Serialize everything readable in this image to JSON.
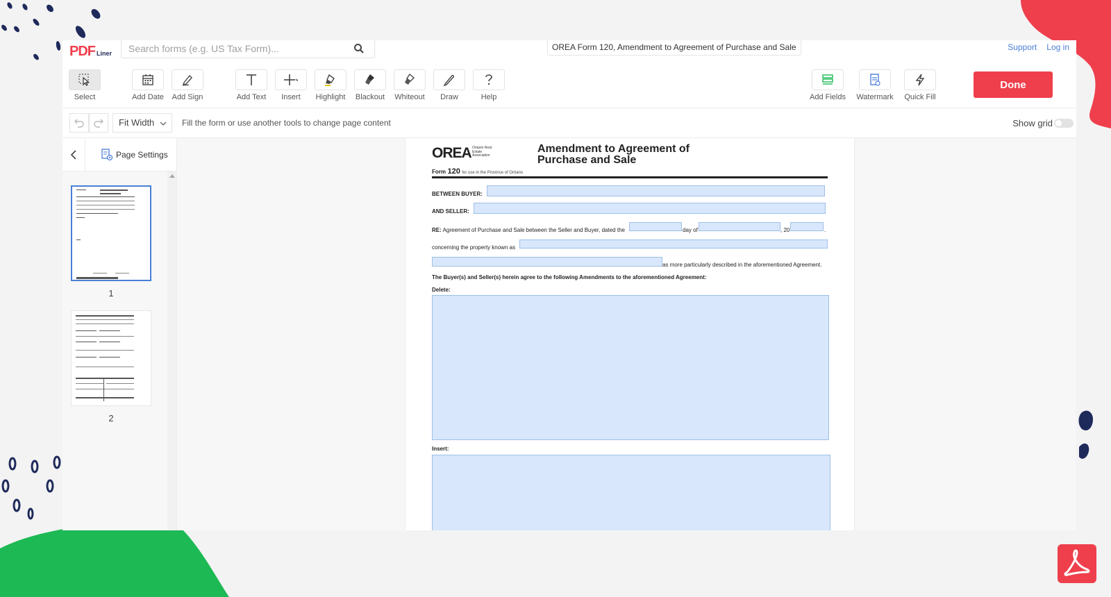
{
  "app": {
    "logo_main": "PDF",
    "logo_sub": "Liner",
    "search_placeholder": "Search forms (e.g. US Tax Form)...",
    "document_title": "OREA Form 120, Amendment to Agreement of Purchase and Sale",
    "support_label": "Support",
    "login_label": "Log in"
  },
  "toolbar": {
    "tools": [
      {
        "id": "select",
        "label": "Select",
        "icon": "cursor-icon",
        "active": true
      },
      {
        "id": "add-date",
        "label": "Add Date",
        "icon": "calendar-icon"
      },
      {
        "id": "add-sign",
        "label": "Add Sign",
        "icon": "pen-sign-icon"
      },
      {
        "id": "add-text",
        "label": "Add Text",
        "icon": "text-t-icon"
      },
      {
        "id": "insert",
        "label": "Insert",
        "icon": "plus-icon"
      },
      {
        "id": "highlight",
        "label": "Highlight",
        "icon": "highlighter-icon"
      },
      {
        "id": "blackout",
        "label": "Blackout",
        "icon": "blackout-brush-icon"
      },
      {
        "id": "whiteout",
        "label": "Whiteout",
        "icon": "whiteout-brush-icon"
      },
      {
        "id": "draw",
        "label": "Draw",
        "icon": "pencil-icon"
      },
      {
        "id": "help",
        "label": "Help",
        "icon": "question-icon"
      },
      {
        "id": "add-fields",
        "label": "Add Fields",
        "icon": "fields-icon"
      },
      {
        "id": "watermark",
        "label": "Watermark",
        "icon": "watermark-icon"
      },
      {
        "id": "quick-fill",
        "label": "Quick Fill",
        "icon": "lightning-icon"
      }
    ],
    "done_label": "Done"
  },
  "subbar": {
    "zoom_value": "Fit Width",
    "hint": "Fill the form or use another tools to change page content",
    "show_grid_label": "Show grid",
    "show_grid_on": false
  },
  "sidebar": {
    "page_settings_label": "Page Settings",
    "pages": [
      {
        "number": "1",
        "selected": true
      },
      {
        "number": "2",
        "selected": false
      }
    ]
  },
  "document": {
    "logo_text": "OREA",
    "logo_small": "Ontario Real Estate Association",
    "title_line1": "Amendment to Agreement of",
    "title_line2": "Purchase and Sale",
    "form_label": "Form",
    "form_number": "120",
    "form_note": "for use in the Province of Ontario",
    "buyer_label": "BETWEEN BUYER:",
    "seller_label": "AND SELLER:",
    "re_bold": "RE:",
    "re_text": "Agreement of Purchase and Sale between the Seller and Buyer, dated the",
    "day_of": "day of",
    "year_prefix": ", 20",
    "year_suffix": ".",
    "concerning": "concerning the property known as",
    "described": "as more particularly described in the aforementioned Agreement.",
    "agree_text": "The Buyer(s) and Seller(s) herein agree to the following Amendments to the aforementioned Agreement:",
    "delete_label": "Delete:",
    "insert_label": "Insert:"
  },
  "colors": {
    "accent_red": "#ef3f4c",
    "link_blue": "#4c7fd8",
    "field_blue": "#d8e7fb",
    "navy": "#1e2a5a",
    "green": "#1db954"
  }
}
